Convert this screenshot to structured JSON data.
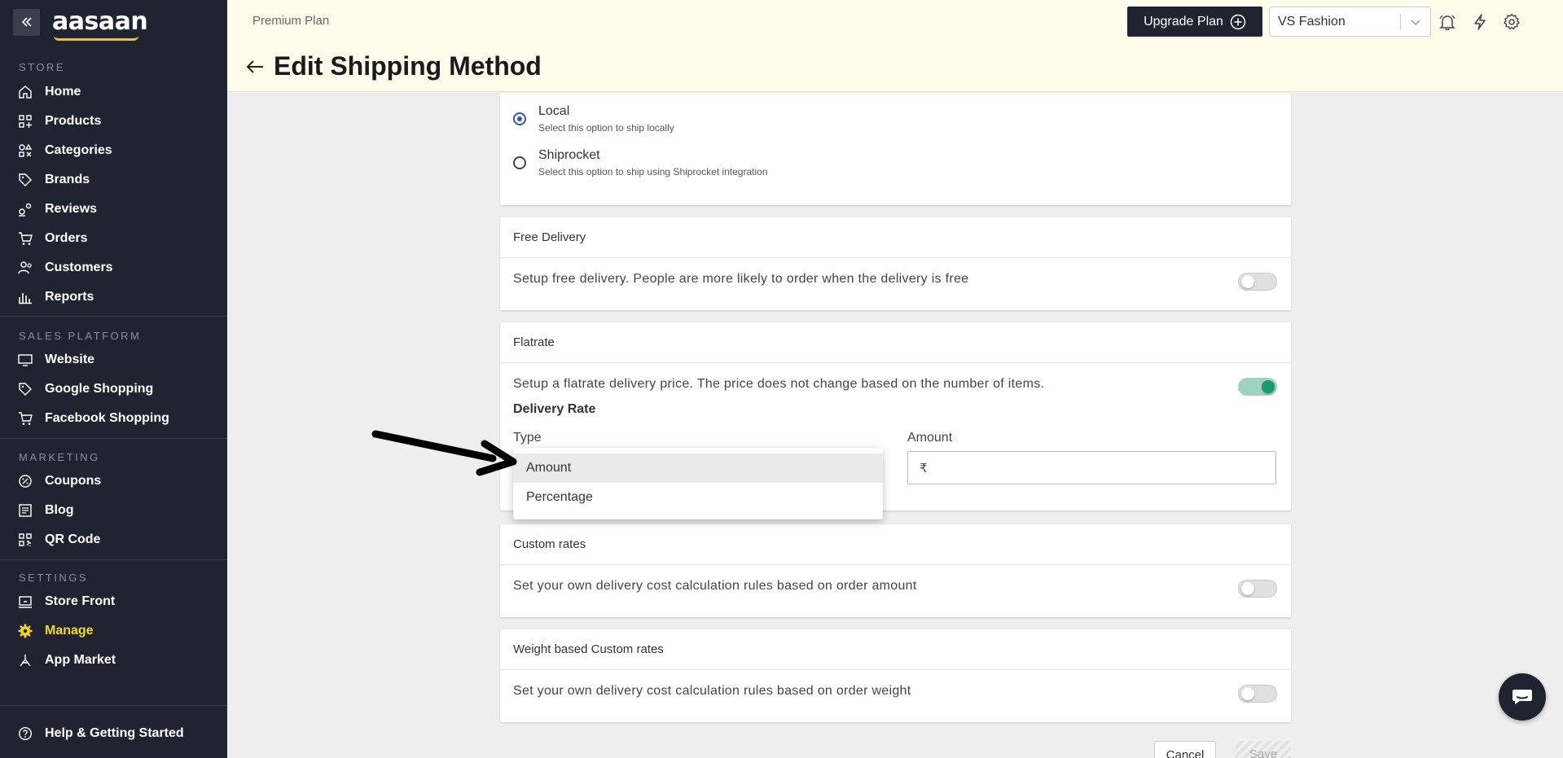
{
  "app": {
    "logo_text": "aasaan"
  },
  "sidebar": {
    "sections": {
      "store": "STORE",
      "sales": "SALES PLATFORM",
      "marketing": "MARKETING",
      "settings": "SETTINGS"
    },
    "store_items": [
      "Home",
      "Products",
      "Categories",
      "Brands",
      "Reviews",
      "Orders",
      "Customers",
      "Reports"
    ],
    "sales_items": [
      "Website",
      "Google Shopping",
      "Facebook Shopping"
    ],
    "marketing_items": [
      "Coupons",
      "Blog",
      "QR Code"
    ],
    "settings_items": [
      "Store Front",
      "Manage",
      "App Market"
    ],
    "active_item": "Manage",
    "help": "Help & Getting Started",
    "accent_color": "#f5d631"
  },
  "header": {
    "plan": "Premium Plan",
    "title": "Edit Shipping Method",
    "upgrade_label": "Upgrade Plan",
    "store_name": "VS Fashion"
  },
  "shipping_type": {
    "options": [
      {
        "label": "Local",
        "description": "Select this option to ship locally",
        "selected": true
      },
      {
        "label": "Shiprocket",
        "description": "Select this option to ship using Shiprocket integration",
        "selected": false
      }
    ]
  },
  "free_delivery": {
    "title": "Free Delivery",
    "description": "Setup free delivery. People are more likely to order when the delivery is free",
    "enabled": false
  },
  "flatrate": {
    "title": "Flatrate",
    "description": "Setup a flatrate delivery price. The price does not change based on the number of items.",
    "enabled": true,
    "delivery_rate_label": "Delivery Rate",
    "type_label": "Type",
    "amount_label": "Amount",
    "amount_prefix": "₹",
    "amount_value": "",
    "type_options": [
      "Amount",
      "Percentage"
    ],
    "highlighted_option": "Amount"
  },
  "custom_rates": {
    "title": "Custom rates",
    "description": "Set your own delivery cost calculation rules based on order amount",
    "enabled": false
  },
  "weight_rates": {
    "title": "Weight based Custom rates",
    "description": "Set your own delivery cost calculation rules based on order weight",
    "enabled": false
  },
  "actions": {
    "cancel": "Cancel",
    "save": "Save"
  },
  "colors": {
    "sidebar_bg": "#1f2430",
    "header_bg": "#fffbeb",
    "toggle_on": "#1d9a6c",
    "radio_checked": "#3b4fc4"
  }
}
